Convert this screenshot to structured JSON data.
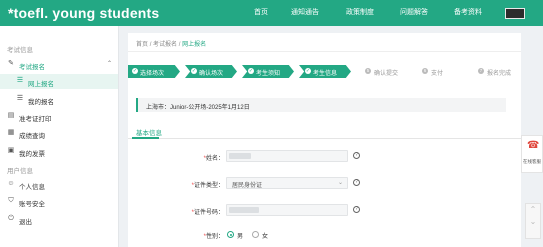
{
  "brand": {
    "logo_text": "*toefl. young students"
  },
  "topnav": {
    "items": [
      "首页",
      "通知通告",
      "政策制度",
      "问题解答",
      "备考资料"
    ]
  },
  "sidebar": {
    "section1": "考试信息",
    "section2": "用户信息",
    "items": {
      "exam_signup": "考试报名",
      "online_signup": "网上报名",
      "my_signup": "我的报名",
      "admission": "准考证打印",
      "score": "成绩查询",
      "my_invoice": "我的发票",
      "personal_info": "个人信息",
      "account_security": "账号安全",
      "logout": "退出"
    }
  },
  "breadcrumb": {
    "home": "首页",
    "sep1": "/",
    "mid": "考试报名",
    "sep2": "/",
    "current": "网上报名"
  },
  "steps": [
    {
      "label": "选择场次",
      "state": "done"
    },
    {
      "label": "确认场次",
      "state": "done"
    },
    {
      "label": "考生须知",
      "state": "done"
    },
    {
      "label": "考生信息",
      "state": "done"
    },
    {
      "label": "确认提交",
      "state": "pending",
      "num": "5"
    },
    {
      "label": "支付",
      "state": "pending",
      "num": "6"
    },
    {
      "label": "报名完成",
      "state": "pending",
      "num": "7"
    }
  ],
  "exam_info": "上海市：Junior-公开场-2025年1月12日",
  "tab": {
    "label": "基本信息"
  },
  "form": {
    "name_label": "姓名：",
    "idtype_label": "证件类型：",
    "idtype_value": "居民身份证",
    "idnum_label": "证件号码：",
    "gender_label": "性别：",
    "gender_male": "男",
    "gender_female": "女",
    "required_mark": "*",
    "help_mark": "?"
  },
  "float_panel": {
    "label": "在线客服"
  },
  "colors": {
    "brand": "#23a884",
    "accent_red": "#e0463c"
  }
}
